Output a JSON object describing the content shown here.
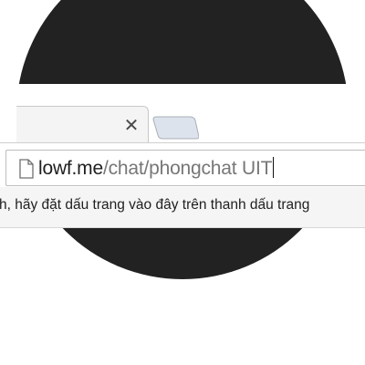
{
  "tab_close_label": "✕",
  "address_bar": {
    "domain": "lowf.me",
    "path": "/chat/phongchat UIT"
  },
  "bookmark_bar": {
    "hint": "h, hãy đặt dấu trang vào đây trên thanh dấu trang"
  },
  "colors": {
    "background": "#ffffff",
    "dark_circle": "#222222",
    "tab_background": "#f4f4f4",
    "new_tab_background": "#dde3ec",
    "bookmark_background": "#f5f5f5",
    "url_path_gray": "#777777"
  },
  "icons": {
    "page": "page-icon",
    "close": "close-icon",
    "new_tab": "new-tab-icon"
  }
}
